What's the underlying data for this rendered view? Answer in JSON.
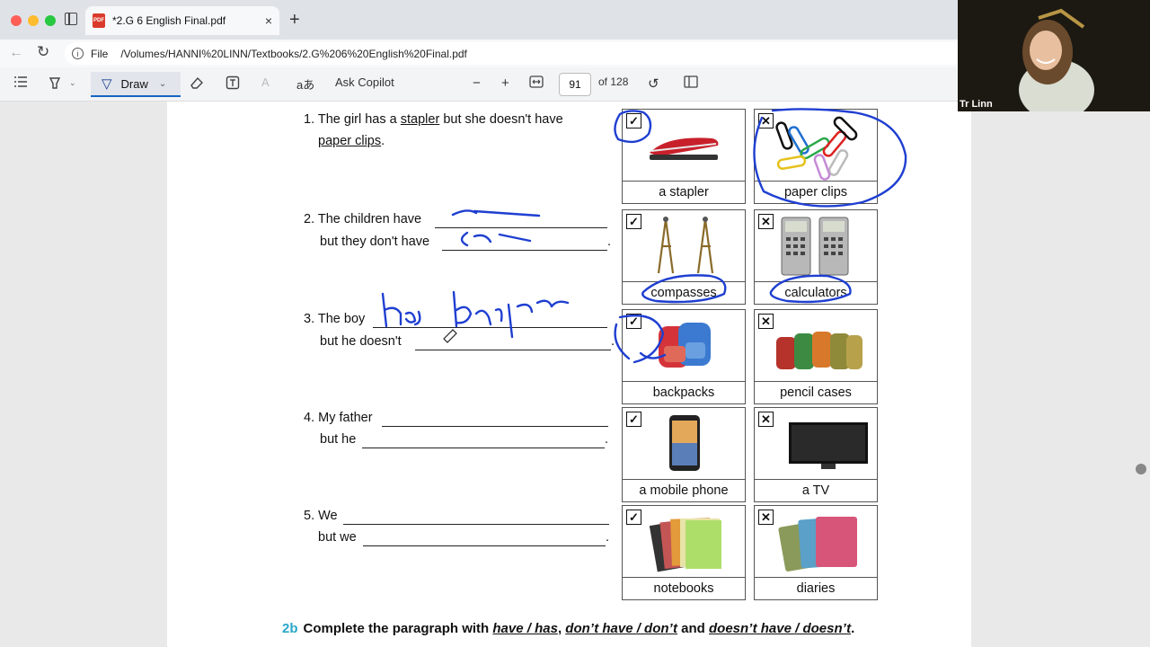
{
  "browser": {
    "tab_title": "*2.G 6 English Final.pdf",
    "tab_close": "×",
    "new_tab": "+",
    "pdf_icon_text": "PDF",
    "url_scheme_label": "File",
    "url": "/Volumes/HANNI%20LINN/Textbooks/2.G%206%20English%20Final.pdf"
  },
  "toolbar": {
    "draw_label": "Draw",
    "read_aloud_glyph": "aあ",
    "copilot_label": "Ask Copilot",
    "zoom_out": "−",
    "zoom_in": "+",
    "page_number": "91",
    "page_total": "of 128"
  },
  "exercise": {
    "item1": {
      "a": "1. The girl has a",
      "stapler": "stapler",
      "b": "but she doesn't have",
      "clips": "paper clips",
      "c": "."
    },
    "item2": {
      "a": "2. The children have",
      "b": "but they don't have",
      "end": "."
    },
    "item3": {
      "a": "3. The boy",
      "b": "but he doesn't",
      "end": "."
    },
    "item4": {
      "a": "4. My father",
      "b": "but he",
      "end": "."
    },
    "item5": {
      "a": "5. We",
      "b": "but we",
      "end": "."
    }
  },
  "cards": [
    {
      "label": "a stapler",
      "mark": "✓"
    },
    {
      "label": "paper clips",
      "mark": "✕"
    },
    {
      "label": "compasses",
      "mark": "✓"
    },
    {
      "label": "calculators",
      "mark": "✕"
    },
    {
      "label": "backpacks",
      "mark": "✓"
    },
    {
      "label": "pencil cases",
      "mark": "✕"
    },
    {
      "label": "a mobile phone",
      "mark": "✓"
    },
    {
      "label": "a TV",
      "mark": "✕"
    },
    {
      "label": "notebooks",
      "mark": "✓"
    },
    {
      "label": "diaries",
      "mark": "✕"
    }
  ],
  "section_b": {
    "num": "2b",
    "text1": "Complete the paragraph with",
    "opt1": "have / has",
    "sep1": ",",
    "opt2": "don’t have / don’t",
    "and": "and",
    "opt3": "doesn’t have / doesn’t",
    "end": "."
  },
  "webcam": {
    "name": "Tr Linn"
  },
  "colors": {
    "ink": "#1f3fd1",
    "accent": "#1565c0",
    "section_num": "#2aa7c9"
  }
}
